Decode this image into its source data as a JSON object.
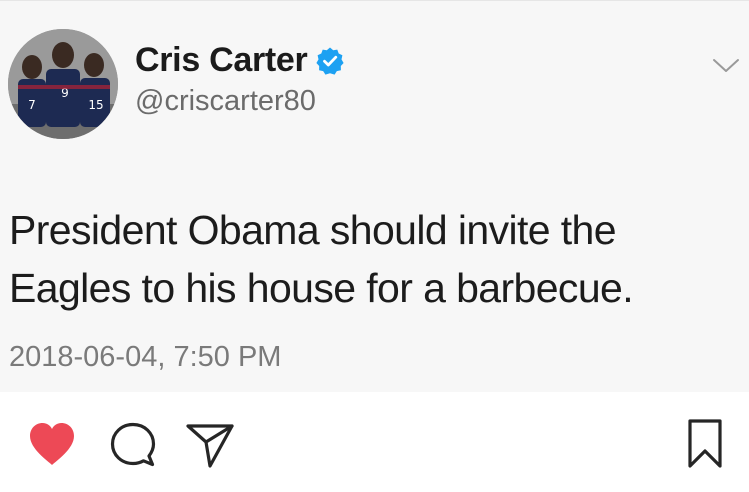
{
  "tweet": {
    "author_name": "Cris Carter",
    "handle": "@criscarter80",
    "text_line1": "President Obama should invite the",
    "text_line2": "Eagles to his house for a barbecue.",
    "timestamp": "2018-06-04, 7:50 PM",
    "verified": true,
    "verified_color": "#1da1f2"
  },
  "actions": {
    "like_icon": "heart-icon",
    "like_color": "#ed4956",
    "comment_icon": "comment-icon",
    "share_icon": "share-icon",
    "save_icon": "bookmark-icon"
  }
}
